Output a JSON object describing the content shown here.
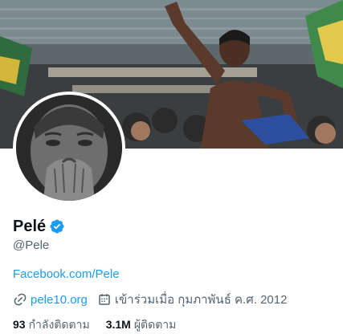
{
  "profile": {
    "display_name": "Pelé",
    "handle": "@Pele",
    "bio_link": "Facebook.com/Pele",
    "website": "pele10.org",
    "joined": "เข้าร่วมเมื่อ กุมภาพันธ์ ค.ศ. 2012"
  },
  "stats": {
    "following_count": "93",
    "following_label": "กำลังติดตาม",
    "followers_count": "3.1M",
    "followers_label": "ผู้ติดตาม"
  },
  "icons": {
    "verified": "verified-badge-icon",
    "link": "link-icon",
    "calendar": "calendar-icon"
  },
  "colors": {
    "accent": "#1d9bf0",
    "text_primary": "#0f1419",
    "text_secondary": "#536471"
  }
}
